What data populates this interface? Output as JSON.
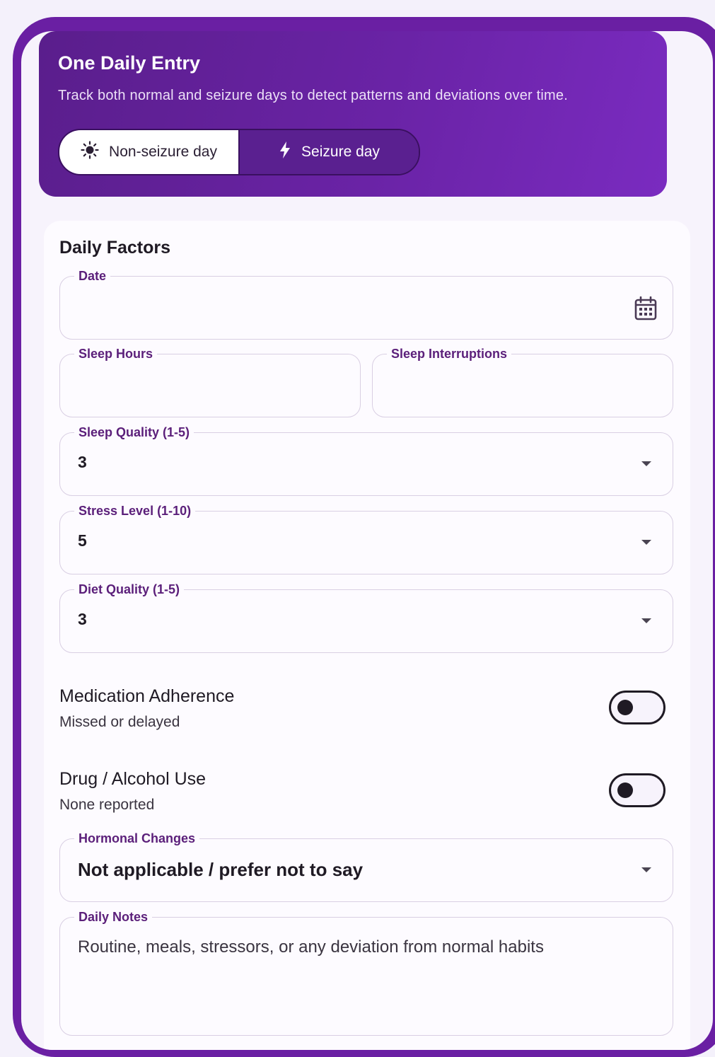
{
  "header": {
    "title": "One Daily Entry",
    "subtitle": "Track both normal and seizure days to detect patterns and deviations over time.",
    "segments": [
      {
        "label": "Non-seizure day",
        "icon": "sun-icon",
        "selected": true
      },
      {
        "label": "Seizure day",
        "icon": "bolt-icon",
        "selected": false
      }
    ]
  },
  "form": {
    "section_title": "Daily Factors",
    "date": {
      "label": "Date",
      "value": ""
    },
    "sleep_hours": {
      "label": "Sleep Hours",
      "value": ""
    },
    "sleep_interruptions": {
      "label": "Sleep Interruptions",
      "value": ""
    },
    "sleep_quality": {
      "label": "Sleep Quality (1-5)",
      "value": "3"
    },
    "stress_level": {
      "label": "Stress Level (1-10)",
      "value": "5"
    },
    "diet_quality": {
      "label": "Diet Quality (1-5)",
      "value": "3"
    },
    "medication": {
      "label": "Medication Adherence",
      "sub": "Missed or delayed",
      "on": false
    },
    "drug_alcohol": {
      "label": "Drug / Alcohol Use",
      "sub": "None reported",
      "on": false
    },
    "hormonal": {
      "label": "Hormonal Changes",
      "value": "Not applicable / prefer not to say"
    },
    "notes": {
      "label": "Daily Notes",
      "placeholder": "Routine, meals, stressors, or any deviation from normal habits"
    }
  },
  "colors": {
    "accent": "#6a1fa3",
    "label": "#5b1f7a"
  }
}
